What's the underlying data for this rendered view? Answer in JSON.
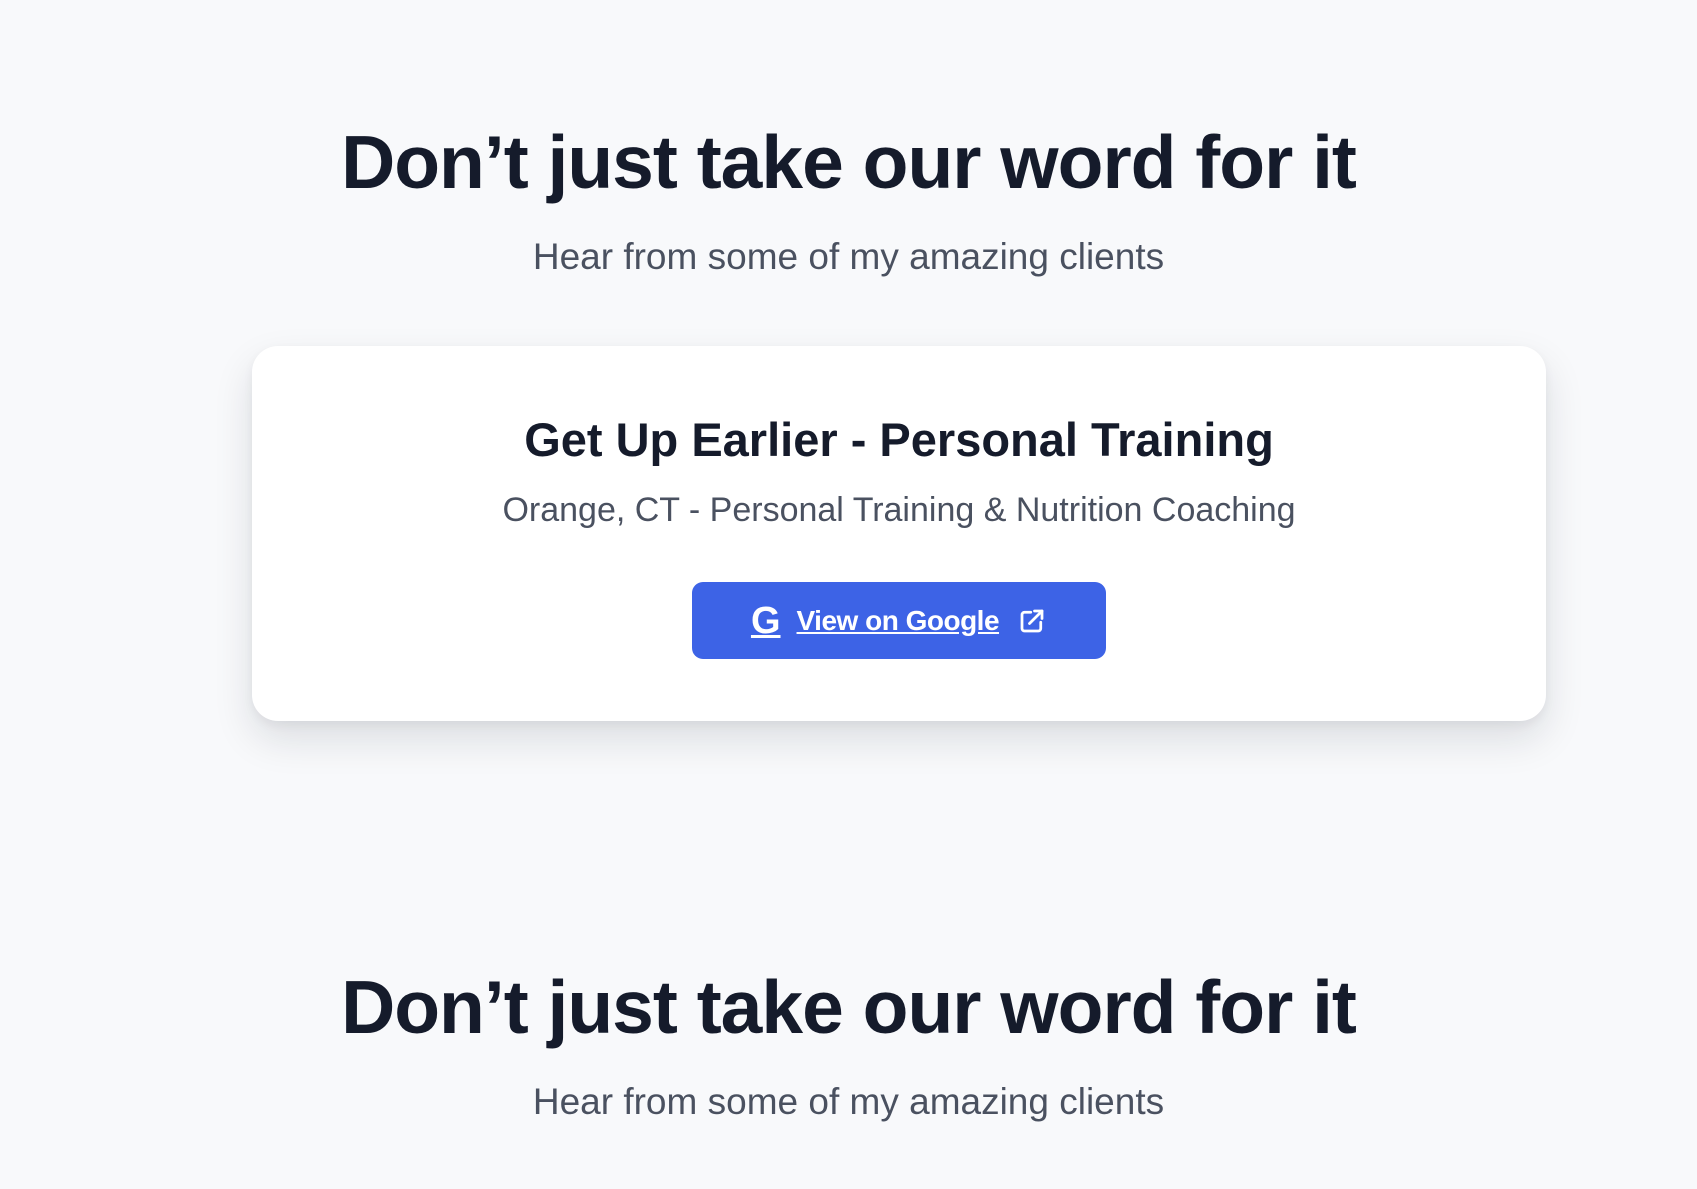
{
  "testimonials_section": {
    "heading": "Don’t just take our word for it",
    "subheading": "Hear from some of my amazing clients"
  },
  "review_card": {
    "title": "Get Up Earlier - Personal Training",
    "subtitle": "Orange, CT - Personal Training & Nutrition Coaching",
    "button_label": "View on Google",
    "button_icon_letter": "G",
    "button_icon": "google-icon",
    "trailing_icon": "external-link-icon",
    "button_color": "#3d63e6"
  },
  "repeated_section": {
    "heading": "Don’t just take our word for it",
    "subheading": "Hear from some of my amazing clients"
  },
  "colors": {
    "page_background": "#f8f9fb",
    "heading_text": "#151b2b",
    "body_text": "#4a5160",
    "card_background": "#ffffff"
  }
}
